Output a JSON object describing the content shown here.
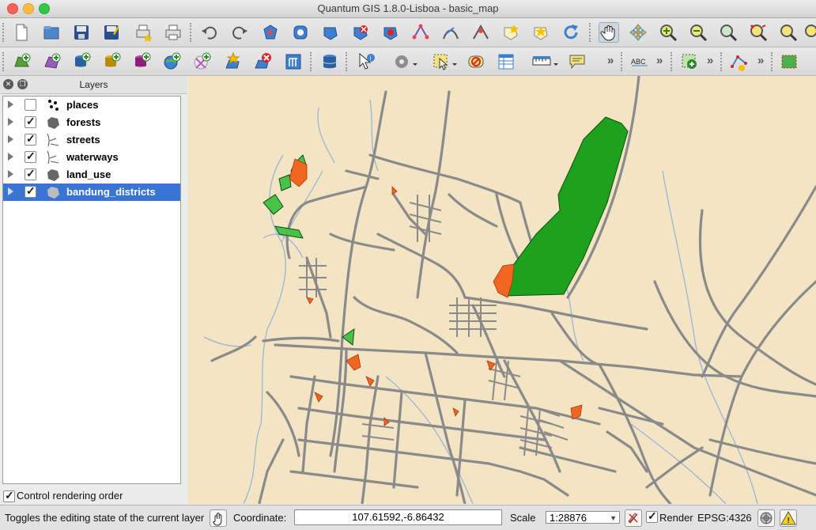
{
  "window": {
    "title": "Quantum GIS 1.8.0-Lisboa - basic_map"
  },
  "toolbar1": {
    "icons": [
      "new-project-icon",
      "open-project-icon",
      "save-project-icon",
      "save-as-icon",
      "new-print-composer-icon",
      "print-icon",
      "undo-icon",
      "redo-icon",
      "select-feature-icon",
      "identify-icon",
      "measure-icon",
      "delete-feature-icon",
      "split-feature-icon",
      "node-tool-icon",
      "add-ring-icon",
      "reshape-icon",
      "merge-icon",
      "fill-ring-icon",
      "refresh-icon",
      "pan-icon",
      "pan-to-selection-icon",
      "zoom-in-icon",
      "zoom-out-icon",
      "zoom-full-icon",
      "zoom-to-selection-icon",
      "zoom-to-layer-icon"
    ]
  },
  "toolbar2": {
    "icons": [
      "add-vector-layer-icon",
      "add-raster-layer-icon",
      "add-postgis-layer-icon",
      "add-spatialite-layer-icon",
      "add-mssql-layer-icon",
      "add-wms-layer-icon",
      "add-wcs-layer-icon",
      "new-shapefile-layer-icon",
      "remove-layer-icon",
      "add-delimited-text-icon",
      "add-oracle-layer-icon",
      "identify-features-icon",
      "actions-gear-icon",
      "select-features-icon",
      "deselect-icon",
      "attribute-table-icon",
      "measure-line-icon",
      "map-tips-icon",
      "label-abc-icon",
      "georeferencer-icon",
      "digitize-node-icon",
      "rectangle-icon"
    ],
    "overflow": "»"
  },
  "layers_panel": {
    "title": "Layers",
    "layers": [
      {
        "name": "places",
        "visible": false,
        "selected": false,
        "icon": "points-icon"
      },
      {
        "name": "forests",
        "visible": true,
        "selected": false,
        "icon": "polygon-icon"
      },
      {
        "name": "streets",
        "visible": true,
        "selected": false,
        "icon": "line-icon"
      },
      {
        "name": "waterways",
        "visible": true,
        "selected": false,
        "icon": "line-icon"
      },
      {
        "name": "land_use",
        "visible": true,
        "selected": false,
        "icon": "polygon-icon"
      },
      {
        "name": "bandung_districts",
        "visible": true,
        "selected": true,
        "icon": "polygon-icon"
      }
    ],
    "control_rendering_label": "Control rendering order"
  },
  "map": {
    "background_color": "#f3e4c4",
    "street_color": "#8a8a8a",
    "waterway_color": "#9ab3d8",
    "forest_color": "#1ea11e",
    "land_use_color": "#f26522"
  },
  "statusbar": {
    "message": "Toggles the editing state of the current layer",
    "coordinate_label": "Coordinate:",
    "coordinate_value": "107.61592,-6.86432",
    "scale_label": "Scale",
    "scale_value": "1:28876",
    "render_label": "Render",
    "crs": "EPSG:4326"
  },
  "colors": {
    "selection": "#3a75d4"
  }
}
